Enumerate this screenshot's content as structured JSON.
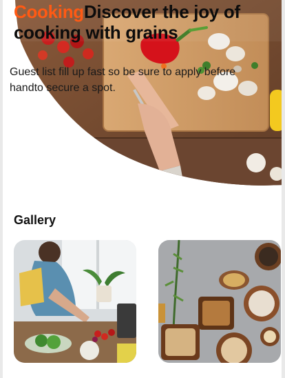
{
  "hero": {
    "title_accent": "Cooking",
    "title_rest": "Discover the joy of cooking with grains",
    "description": "Guest list fill up fast so be sure to apply before handto secure a spot."
  },
  "gallery": {
    "heading": "Gallery",
    "images": [
      {
        "name": "woman-cooking-vegetables-photo"
      },
      {
        "name": "grains-and-spices-bowls-photo"
      }
    ]
  },
  "colors": {
    "accent": "#ff5a14",
    "text": "#111111",
    "background": "#ffffff"
  }
}
